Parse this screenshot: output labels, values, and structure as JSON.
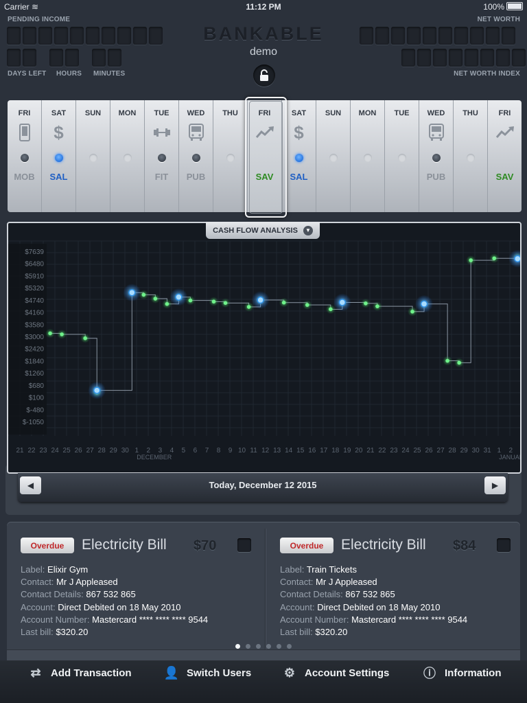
{
  "status_bar": {
    "carrier": "Carrier",
    "time": "11:12 PM",
    "battery": "100%"
  },
  "header": {
    "pending_income_label": "PENDING INCOME",
    "net_worth_label": "NET WORTH",
    "days_left_label": "DAYS LEFT",
    "hours_label": "HOURS",
    "minutes_label": "MINUTES",
    "net_worth_index_label": "NET WORTH INDEX",
    "brand": "BANKABLE",
    "user": "demo"
  },
  "days": [
    {
      "day": "FRI",
      "icon": "phone-icon",
      "code": "MOB",
      "dot": "on",
      "code_color": "#8a9099"
    },
    {
      "day": "SAT",
      "icon": "dollar-icon",
      "code": "SAL",
      "dot": "blue",
      "code_color": "#1f5fc4"
    },
    {
      "day": "SUN",
      "icon": "",
      "code": "",
      "dot": "off",
      "code_color": "#8a9099"
    },
    {
      "day": "MON",
      "icon": "",
      "code": "",
      "dot": "off",
      "code_color": "#8a9099"
    },
    {
      "day": "TUE",
      "icon": "dumbbell-icon",
      "code": "FIT",
      "dot": "on",
      "code_color": "#8a9099"
    },
    {
      "day": "WED",
      "icon": "bus-icon",
      "code": "PUB",
      "dot": "on",
      "code_color": "#8a9099"
    },
    {
      "day": "THU",
      "icon": "",
      "code": "",
      "dot": "off",
      "code_color": "#8a9099"
    },
    {
      "day": "FRI",
      "icon": "trend-up-icon",
      "code": "SAV",
      "dot": "none",
      "code_color": "#2e8b22",
      "selected": true
    },
    {
      "day": "SAT",
      "icon": "dollar-icon",
      "code": "SAL",
      "dot": "blue",
      "code_color": "#1f5fc4"
    },
    {
      "day": "SUN",
      "icon": "",
      "code": "",
      "dot": "off",
      "code_color": "#8a9099"
    },
    {
      "day": "MON",
      "icon": "",
      "code": "",
      "dot": "off",
      "code_color": "#8a9099"
    },
    {
      "day": "TUE",
      "icon": "",
      "code": "",
      "dot": "off",
      "code_color": "#8a9099"
    },
    {
      "day": "WED",
      "icon": "bus-icon",
      "code": "PUB",
      "dot": "on",
      "code_color": "#8a9099"
    },
    {
      "day": "THU",
      "icon": "",
      "code": "",
      "dot": "off",
      "code_color": "#8a9099"
    },
    {
      "day": "FRI",
      "icon": "trend-up-icon",
      "code": "SAV",
      "dot": "none",
      "code_color": "#2e8b22"
    }
  ],
  "chart_header": {
    "label": "CASH FLOW ANALYSIS"
  },
  "chart_data": {
    "type": "line",
    "yticks": [
      "$7639",
      "$6480",
      "$5910",
      "$5320",
      "$4740",
      "$4160",
      "$3580",
      "$3000",
      "$2420",
      "$1840",
      "$1260",
      "$680",
      "$100",
      "$-480",
      "$-1050"
    ],
    "xticks": [
      "21",
      "22",
      "23",
      "24",
      "25",
      "26",
      "27",
      "28",
      "29",
      "30",
      "1",
      "2",
      "3",
      "4",
      "5",
      "6",
      "7",
      "8",
      "9",
      "10",
      "11",
      "12",
      "13",
      "14",
      "15",
      "16",
      "17",
      "18",
      "19",
      "20",
      "21",
      "22",
      "23",
      "24",
      "25",
      "26",
      "27",
      "28",
      "29",
      "30",
      "31",
      "1",
      "2"
    ],
    "highlight_tick": "12",
    "month_labels": [
      {
        "label": "DECEMBER",
        "at_index": 10
      },
      {
        "label": "JANUARY",
        "at_index": 41
      }
    ],
    "ylim": [
      -1050,
      7639
    ],
    "series": [
      {
        "x": [
          24,
          25,
          27,
          28,
          28,
          31,
          32,
          33,
          34,
          35,
          36,
          38,
          39,
          41,
          42,
          44,
          46,
          48,
          49,
          51,
          52,
          55,
          56,
          58,
          59,
          60,
          62,
          64,
          65
        ],
        "y": [
          3450,
          3400,
          3200,
          430,
          540,
          5530,
          5420,
          5220,
          4950,
          5300,
          5130,
          5070,
          5000,
          4800,
          5150,
          5020,
          4900,
          4680,
          5030,
          4980,
          4830,
          4560,
          4950,
          2050,
          1950,
          7180,
          7280,
          7330,
          7330
        ]
      }
    ],
    "markers": [
      {
        "x": 28,
        "y": 540,
        "kind": "major"
      },
      {
        "x": 31,
        "y": 5530,
        "kind": "major"
      },
      {
        "x": 35,
        "y": 5300,
        "kind": "major"
      },
      {
        "x": 42,
        "y": 5150,
        "kind": "major"
      },
      {
        "x": 49,
        "y": 5030,
        "kind": "major"
      },
      {
        "x": 56,
        "y": 4950,
        "kind": "major"
      },
      {
        "x": 64,
        "y": 7260,
        "kind": "major"
      },
      {
        "x": 65,
        "y": 7330,
        "kind": "major"
      }
    ]
  },
  "date_nav": {
    "prev": "◀",
    "next": "▶",
    "today_label": "Today, December 12 2015"
  },
  "cards": [
    {
      "badge": "Overdue",
      "title": "Electricity Bill",
      "amount": "$70",
      "label_key": "Label:",
      "label_val": "Elixir Gym",
      "contact_key": "Contact:",
      "contact_val": "Mr J Appleased",
      "contact_details_key": "Contact Details:",
      "contact_details_val": "867 532 865",
      "account_key": "Account:",
      "account_val": "Direct Debited on 18 May 2010",
      "account_number_key": "Account Number:",
      "account_number_val": "Mastercard **** **** **** 9544",
      "last_bill_key": "Last bill:",
      "last_bill_val": "$320.20"
    },
    {
      "badge": "Overdue",
      "title": "Electricity Bill",
      "amount": "$84",
      "label_key": "Label:",
      "label_val": "Train Tickets",
      "contact_key": "Contact:",
      "contact_val": "Mr J Appleased",
      "contact_details_key": "Contact Details:",
      "contact_details_val": "867 532 865",
      "account_key": "Account:",
      "account_val": "Direct Debited on 18 May 2010",
      "account_number_key": "Account Number:",
      "account_number_val": "Mastercard **** **** **** 9544",
      "last_bill_key": "Last bill:",
      "last_bill_val": "$320.20"
    }
  ],
  "pager": {
    "count": 6,
    "active": 0
  },
  "toolbar": {
    "add_transaction": "Add Transaction",
    "switch_users": "Switch Users",
    "account_settings": "Account Settings",
    "information": "Information"
  },
  "colors": {
    "background": "#2b313b",
    "accent_blue": "#1f5fc4",
    "save_green": "#2e8b22",
    "overdue_red": "#c0282a",
    "point_green": "#5cf07a",
    "point_blue": "#58b6ff"
  }
}
